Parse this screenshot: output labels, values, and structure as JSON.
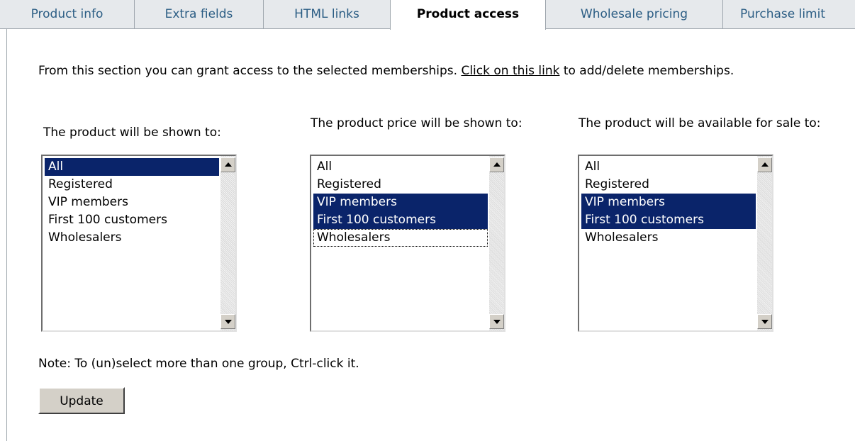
{
  "tabs": [
    {
      "label": "Product info",
      "active": false
    },
    {
      "label": "Extra fields",
      "active": false
    },
    {
      "label": "HTML links",
      "active": false
    },
    {
      "label": "Product access",
      "active": true
    },
    {
      "label": "Wholesale pricing",
      "active": false
    },
    {
      "label": "Purchase limit",
      "active": false
    }
  ],
  "intro": {
    "text_before": "From this section you can grant access to the selected memberships. ",
    "link": "Click on this link",
    "text_after": " to add/delete memberships."
  },
  "lists": [
    {
      "label": "The product will be shown to:",
      "options": [
        {
          "text": "All",
          "selected": true,
          "focused": false
        },
        {
          "text": "Registered",
          "selected": false,
          "focused": false
        },
        {
          "text": "VIP members",
          "selected": false,
          "focused": false
        },
        {
          "text": "First 100 customers",
          "selected": false,
          "focused": false
        },
        {
          "text": "Wholesalers",
          "selected": false,
          "focused": false
        }
      ]
    },
    {
      "label": "The product price will be shown to:",
      "options": [
        {
          "text": "All",
          "selected": false,
          "focused": false
        },
        {
          "text": "Registered",
          "selected": false,
          "focused": false
        },
        {
          "text": "VIP members",
          "selected": true,
          "focused": false
        },
        {
          "text": "First 100 customers",
          "selected": true,
          "focused": false
        },
        {
          "text": "Wholesalers",
          "selected": false,
          "focused": true
        }
      ]
    },
    {
      "label": "The product will be available for sale to:",
      "options": [
        {
          "text": "All",
          "selected": false,
          "focused": false
        },
        {
          "text": "Registered",
          "selected": false,
          "focused": false
        },
        {
          "text": "VIP members",
          "selected": true,
          "focused": false
        },
        {
          "text": "First 100 customers",
          "selected": true,
          "focused": false
        },
        {
          "text": "Wholesalers",
          "selected": false,
          "focused": false
        }
      ]
    }
  ],
  "note": "Note: To (un)select more than one group, Ctrl-click it.",
  "update_label": "Update",
  "colors": {
    "tab_text": "#2b5d84",
    "selection": "#0a246a"
  }
}
